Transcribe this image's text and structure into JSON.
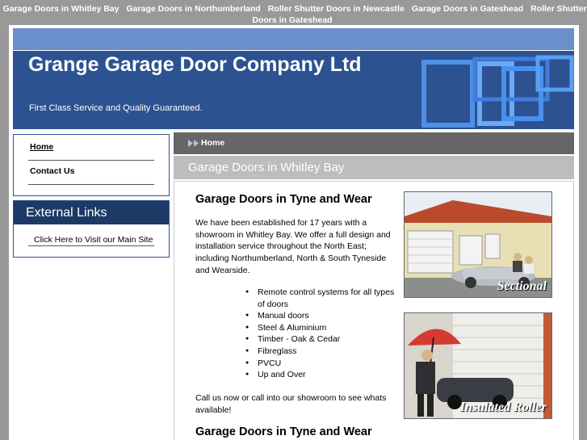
{
  "top_links": [
    "Garage Doors in Whitley Bay",
    "Garage Doors in Northumberland",
    "Roller Shutter Doors in Newcastle",
    "Garage Doors in Gateshead",
    "Roller Shutter Doors in Gateshead"
  ],
  "header": {
    "title": "Grange Garage Door Company Ltd",
    "slogan": "First Class Service and Quality Guaranteed."
  },
  "nav": {
    "home": "Home",
    "contact": "Contact Us"
  },
  "external": {
    "title": "External Links",
    "link": "Click Here to Visit our Main Site"
  },
  "breadcrumb": {
    "home": "Home"
  },
  "page": {
    "title": "Garage Doors in Whitley Bay",
    "heading1": "Garage Doors in Tyne and Wear",
    "intro": "We have been established for 17 years with a showroom in Whitley Bay. We offer a full design and installation service throughout the North East; including Northumberland, North & South Tyneside and Wearside.",
    "list": [
      "Remote control systems for all types of doors",
      "Manual doors",
      "Steel & Aluminium",
      "Timber - Oak & Cedar",
      "Fibreglass",
      "PVCU",
      "Up and Over"
    ],
    "call": "Call us now or call into our showroom to see whats available!",
    "heading2": "Garage Doors in Tyne and Wear"
  },
  "images": {
    "sectional_caption": "Sectional",
    "roller_caption": "Insulated Roller"
  },
  "colors": {
    "header_blue": "#2d5291",
    "strip_blue": "#6a8fcb",
    "dark_blue": "#1d3a66"
  }
}
